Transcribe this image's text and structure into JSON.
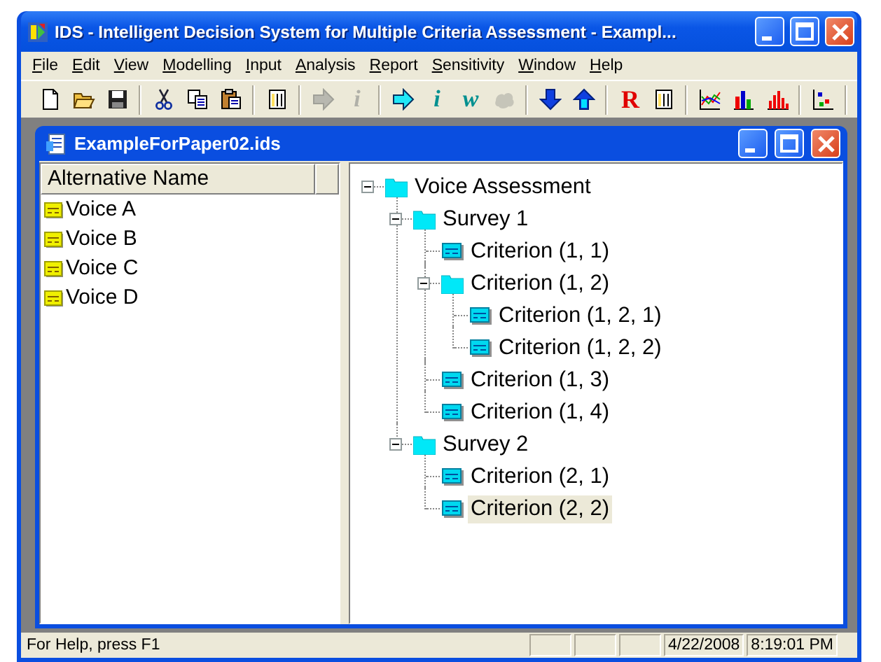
{
  "window": {
    "title": "IDS - Intelligent Decision System for Multiple Criteria Assessment - Exampl..."
  },
  "menu": [
    "File",
    "Edit",
    "View",
    "Modelling",
    "Input",
    "Analysis",
    "Report",
    "Sensitivity",
    "Window",
    "Help"
  ],
  "toolbar_groups": [
    [
      {
        "kind": "new",
        "disabled": false
      },
      {
        "kind": "open",
        "disabled": false
      },
      {
        "kind": "save",
        "disabled": false
      }
    ],
    [
      {
        "kind": "cut",
        "disabled": false
      },
      {
        "kind": "copy",
        "disabled": false
      },
      {
        "kind": "paste",
        "disabled": false
      }
    ],
    [
      {
        "kind": "table",
        "disabled": false
      }
    ],
    [
      {
        "kind": "arrow-right",
        "disabled": true
      },
      {
        "kind": "letter",
        "glyph": "i",
        "disabled": true
      }
    ],
    [
      {
        "kind": "arrow-right",
        "disabled": false
      },
      {
        "kind": "letter",
        "glyph": "i",
        "color": "#009090",
        "disabled": false
      },
      {
        "kind": "letter",
        "glyph": "w",
        "color": "#009090",
        "disabled": false
      },
      {
        "kind": "blob",
        "disabled": true
      }
    ],
    [
      {
        "kind": "arrow-down",
        "disabled": false
      },
      {
        "kind": "arrow-up",
        "disabled": false
      }
    ],
    [
      {
        "kind": "letter",
        "glyph": "R",
        "color": "#e00000",
        "disabled": false
      },
      {
        "kind": "table",
        "disabled": false
      }
    ],
    [
      {
        "kind": "line-chart",
        "disabled": false
      },
      {
        "kind": "bar-chart",
        "disabled": false
      },
      {
        "kind": "histogram",
        "disabled": false
      }
    ],
    [
      {
        "kind": "scatter",
        "disabled": false
      }
    ]
  ],
  "document": {
    "title": "ExampleForPaper02.ids",
    "alternatives": {
      "columns": [
        "Alternative Name"
      ],
      "rows": [
        "Voice A",
        "Voice B",
        "Voice C",
        "Voice D"
      ]
    },
    "tree": {
      "label": "Voice Assessment",
      "kind": "folder",
      "expanded": true,
      "selected": false,
      "children": [
        {
          "label": "Survey 1",
          "kind": "folder",
          "expanded": true,
          "selected": false,
          "children": [
            {
              "label": "Criterion (1, 1)",
              "kind": "criterion",
              "selected": false
            },
            {
              "label": "Criterion (1, 2)",
              "kind": "folder",
              "expanded": true,
              "selected": false,
              "children": [
                {
                  "label": "Criterion (1, 2, 1)",
                  "kind": "criterion",
                  "selected": false
                },
                {
                  "label": "Criterion (1, 2, 2)",
                  "kind": "criterion",
                  "selected": false
                }
              ]
            },
            {
              "label": "Criterion (1, 3)",
              "kind": "criterion",
              "selected": false
            },
            {
              "label": "Criterion (1, 4)",
              "kind": "criterion",
              "selected": false
            }
          ]
        },
        {
          "label": "Survey 2",
          "kind": "folder",
          "expanded": true,
          "selected": false,
          "children": [
            {
              "label": "Criterion (2, 1)",
              "kind": "criterion",
              "selected": false
            },
            {
              "label": "Criterion (2, 2)",
              "kind": "criterion",
              "selected": true
            }
          ]
        }
      ]
    }
  },
  "status_bar": {
    "message": "For Help, press F1",
    "date": "4/22/2008",
    "time": "8:19:01 PM"
  }
}
